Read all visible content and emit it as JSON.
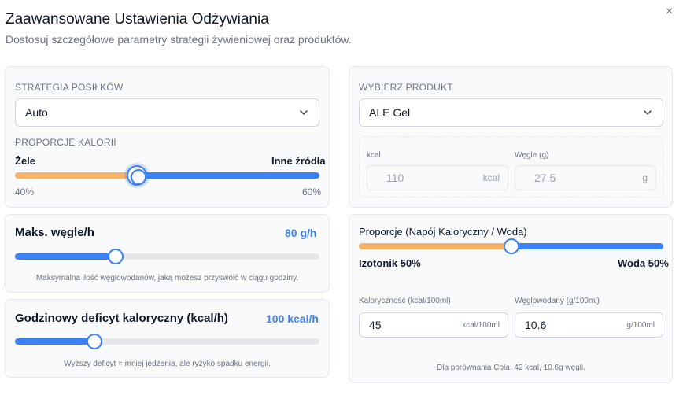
{
  "header": {
    "title": "Zaawansowane Ustawienia Odżywiania",
    "subtitle": "Dostosuj szczegółowe parametry strategii żywieniowej oraz produktów.",
    "close_glyph": "×"
  },
  "strategy": {
    "label": "Strategia posiłków",
    "selected": "Auto",
    "proportions_label": "Proporcje kalorii",
    "left_label": "Żele",
    "right_label": "Inne źródła",
    "left_pct": "40%",
    "right_pct": "60%",
    "gel_share": 0.4
  },
  "max_carbs": {
    "label": "Maks. węgle/h",
    "value": "80 g/h",
    "level": 0.33,
    "caption": "Maksymalna ilość węglowodanów, jaką możesz przyswoić w ciągu godziny."
  },
  "deficit": {
    "label": "Godzinowy deficyt kaloryczny (kcal/h)",
    "value": "100 kcal/h",
    "level": 0.26,
    "caption": "Wyższy deficyt = mniej jedzenia, ale ryzyko spadku energii."
  },
  "product": {
    "label": "Wybierz produkt",
    "selected": "ALE Gel",
    "kcal_label": "kcal",
    "kcal_value": "110",
    "kcal_unit": "kcal",
    "carbs_label": "Węgle (g)",
    "carbs_value": "27.5",
    "carbs_unit": "g"
  },
  "drink": {
    "label": "Proporcje (Napój Kaloryczny / Woda)",
    "left_label": "Izotonik 50%",
    "right_label": "Woda 50%",
    "share": 0.5,
    "calorie_label": "Kaloryczność (kcal/100ml)",
    "calorie_value": "45",
    "calorie_unit": "kcal/100ml",
    "carb_label": "Węglowodany (g/100ml)",
    "carb_value": "10.6",
    "carb_unit": "g/100ml",
    "caption": "Dla porównania Cola: 42 kcal, 10.6g węgli."
  },
  "colors": {
    "accent": "#3b82f6",
    "orange": "#f6b26b",
    "track": "#e5e7eb"
  }
}
